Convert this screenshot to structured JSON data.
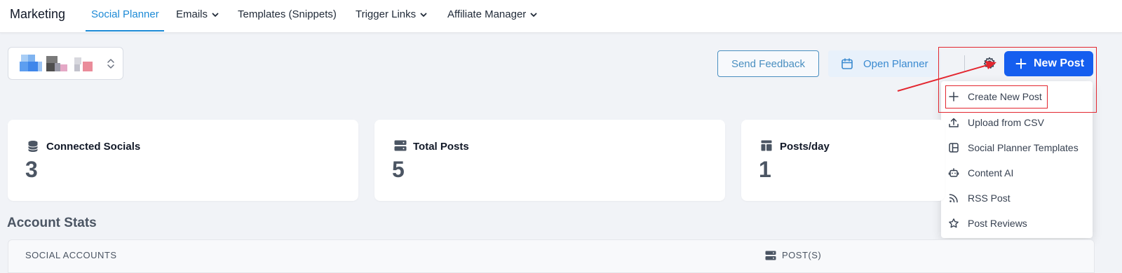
{
  "nav": {
    "brand": "Marketing",
    "tabs": [
      {
        "label": "Social Planner",
        "active": true,
        "dropdown": false
      },
      {
        "label": "Emails",
        "dropdown": true
      },
      {
        "label": "Templates (Snippets)",
        "dropdown": false
      },
      {
        "label": "Trigger Links",
        "dropdown": true
      },
      {
        "label": "Affiliate Manager",
        "dropdown": true
      }
    ]
  },
  "toolbar": {
    "feedback_label": "Send Feedback",
    "planner_label": "Open Planner",
    "new_post_label": "New Post",
    "plus_glyph": "+"
  },
  "new_post_menu": {
    "items": [
      {
        "label": "Create New Post",
        "icon": "plus-icon"
      },
      {
        "label": "Upload from CSV",
        "icon": "upload-icon"
      },
      {
        "label": "Social Planner Templates",
        "icon": "template-icon"
      },
      {
        "label": "Content AI",
        "icon": "robot-icon"
      },
      {
        "label": "RSS Post",
        "icon": "rss-icon"
      },
      {
        "label": "Post Reviews",
        "icon": "star-icon"
      }
    ]
  },
  "stats": [
    {
      "title": "Connected Socials",
      "value": "3",
      "icon": "database-icon"
    },
    {
      "title": "Total Posts",
      "value": "5",
      "icon": "server-icon"
    },
    {
      "title": "Posts/day",
      "value": "1",
      "icon": "layout-icon"
    }
  ],
  "account_stats": {
    "title": "Account Stats",
    "columns": [
      "SOCIAL ACCOUNTS",
      "POST(S)"
    ]
  },
  "colors": {
    "accent": "#155eef",
    "active_tab": "#1d8ad6",
    "annotation_red": "#e3262f"
  }
}
